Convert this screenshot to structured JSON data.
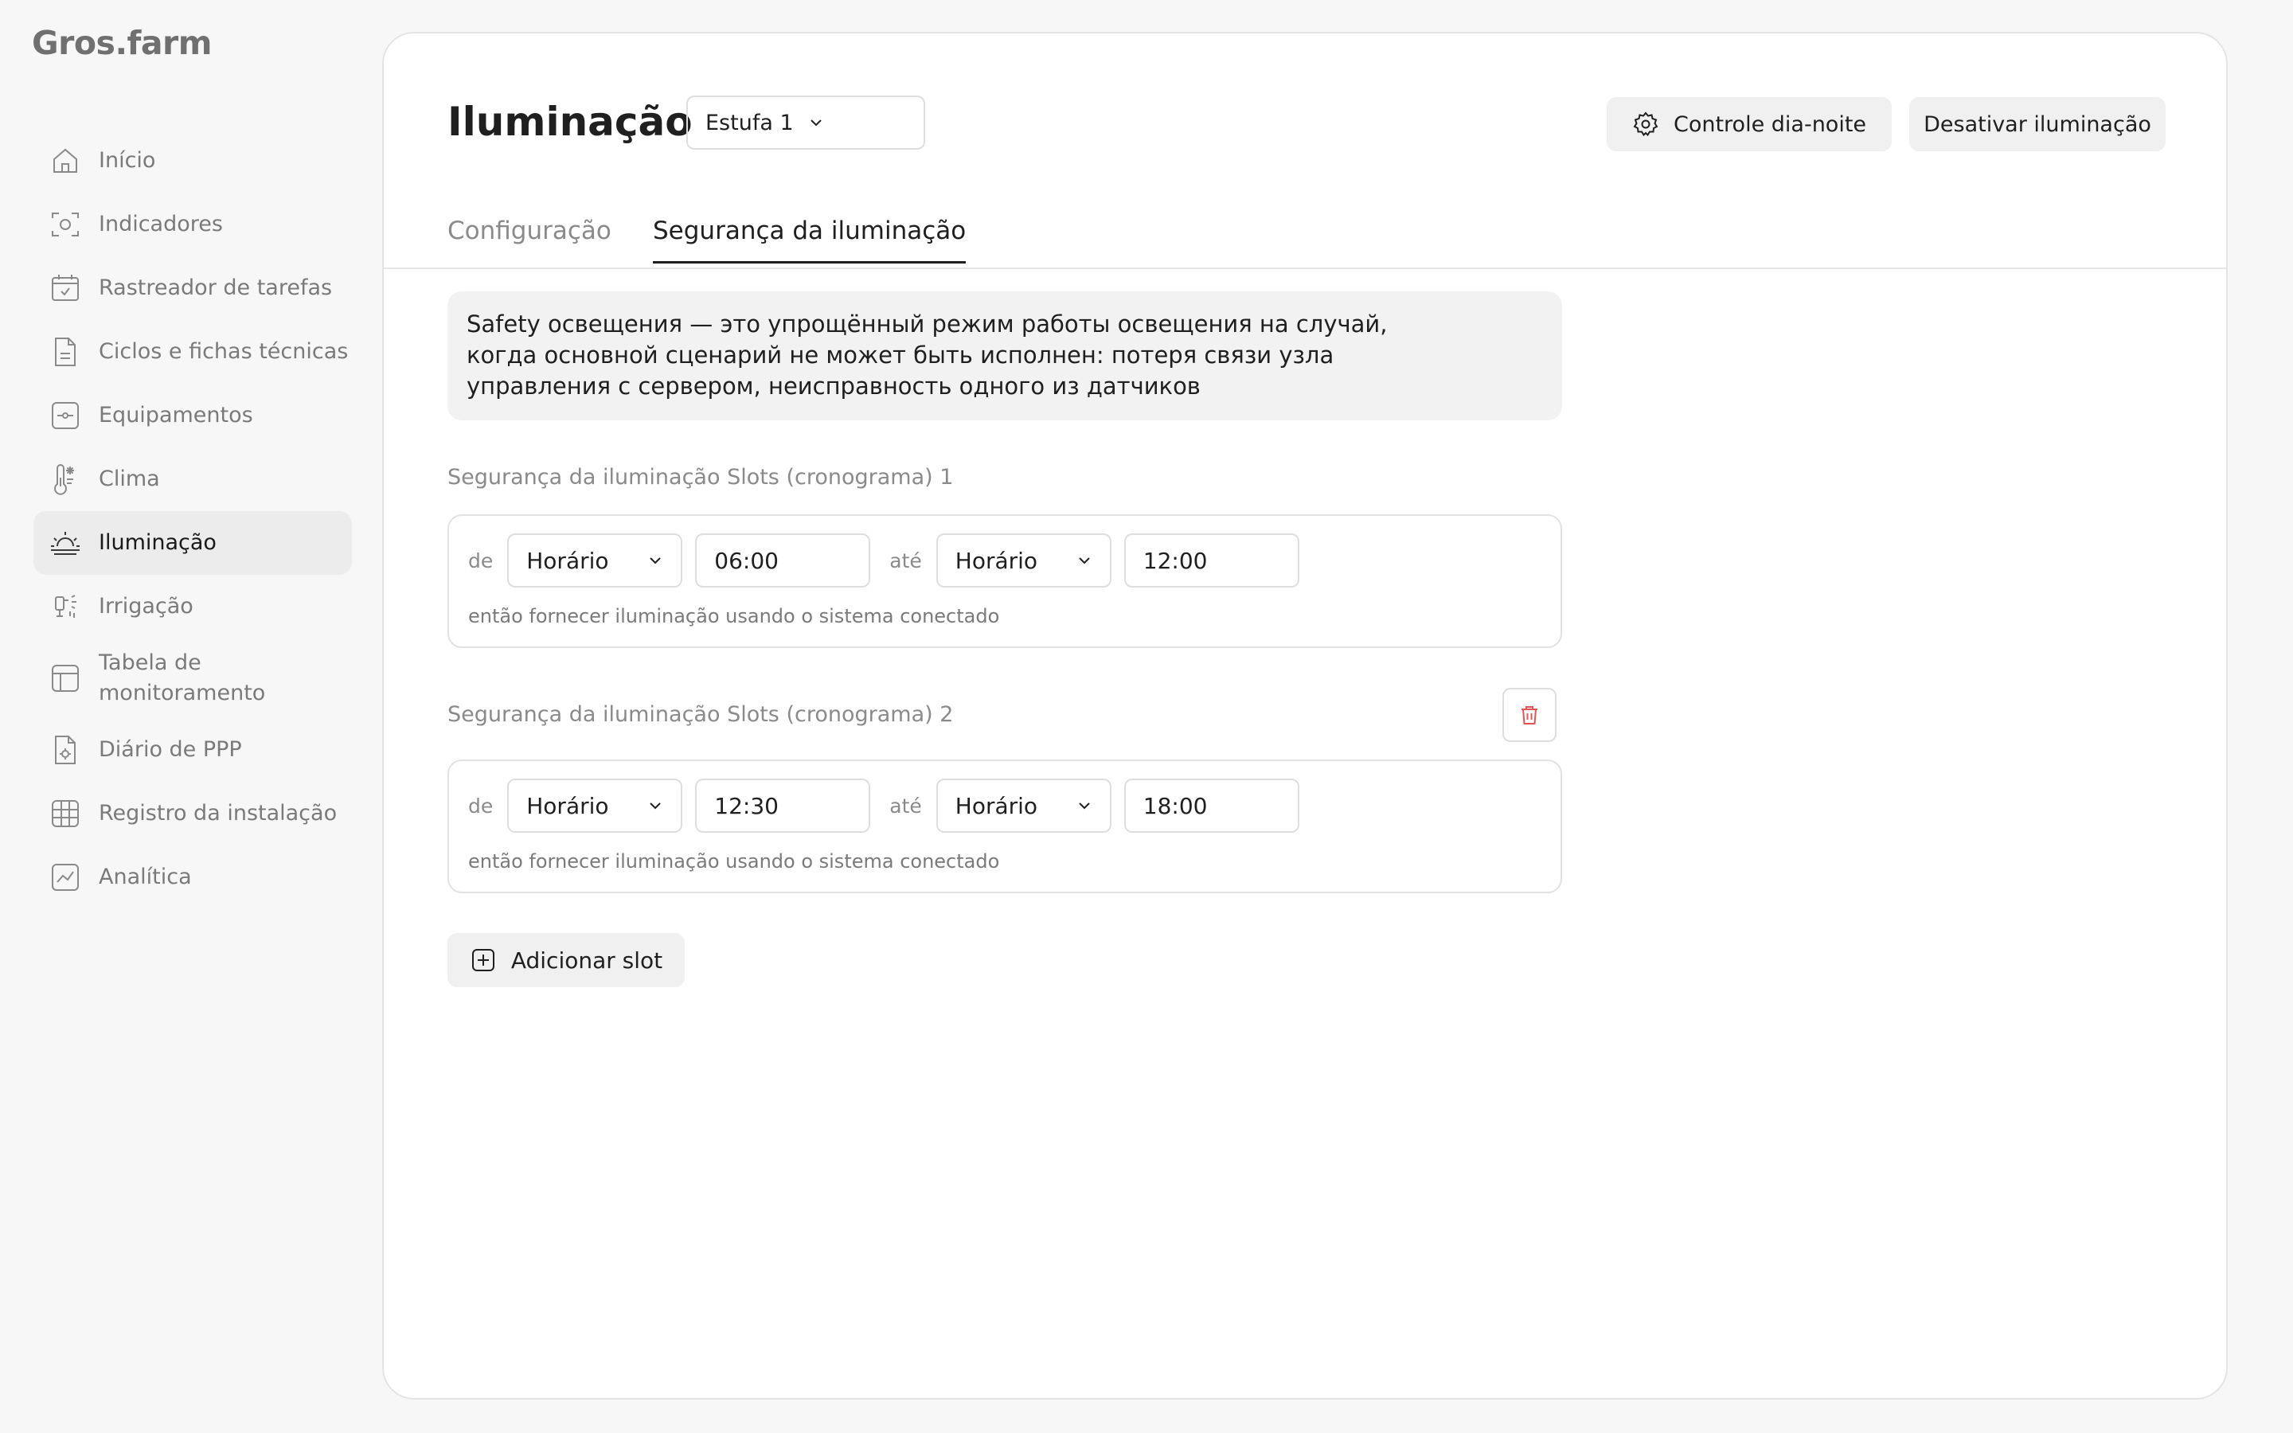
{
  "app": {
    "logo": "Gros.farm"
  },
  "sidebar": {
    "items": [
      {
        "label": "Início",
        "icon": "home-icon"
      },
      {
        "label": "Indicadores",
        "icon": "camera-icon"
      },
      {
        "label": "Rastreador de tarefas",
        "icon": "calendar-check-icon"
      },
      {
        "label": "Ciclos e fichas técnicas",
        "icon": "document-icon"
      },
      {
        "label": "Equipamentos",
        "icon": "equipment-icon"
      },
      {
        "label": "Clima",
        "icon": "thermometer-icon"
      },
      {
        "label": "Iluminação",
        "icon": "sunrise-icon",
        "active": true
      },
      {
        "label": "Irrigação",
        "icon": "sprinkler-icon"
      },
      {
        "label": "Tabela de monitoramento",
        "icon": "table-icon"
      },
      {
        "label": "Diário de PPP",
        "icon": "ppp-document-icon"
      },
      {
        "label": "Registro da instalação",
        "icon": "grid-icon"
      },
      {
        "label": "Analítica",
        "icon": "chart-icon"
      }
    ]
  },
  "header": {
    "title": "Iluminação",
    "greenhouse_select": "Estufa 1",
    "daynight_button": "Controle dia-noite",
    "disable_button": "Desativar iluminação"
  },
  "tabs": {
    "config": "Configuração",
    "safety": "Segurança da iluminação",
    "active": "safety"
  },
  "info": {
    "line1": "Safety освещения — это упрощённый режим работы освещения на случай,",
    "line2": "когда основной сценарий не может быть исполнен: потеря связи узла",
    "line3": "управления с сервером,  неисправность одного из датчиков"
  },
  "labels": {
    "from": "de",
    "to": "até"
  },
  "slots": [
    {
      "title": "Segurança da iluminação Slots (cronograma) 1",
      "from_type": "Horário",
      "from_time": "06:00",
      "to_type": "Horário",
      "to_time": "12:00",
      "hint": "então fornecer iluminação usando o sistema conectado"
    },
    {
      "title": "Segurança da iluminação Slots (cronograma) 2",
      "from_type": "Horário",
      "from_time": "12:30",
      "to_type": "Horário",
      "to_time": "18:00",
      "hint": "então fornecer iluminação usando o sistema conectado"
    }
  ],
  "add_slot_button": "Adicionar slot",
  "colors": {
    "accent_delete": "#e05555",
    "active_bg": "#ececec"
  }
}
